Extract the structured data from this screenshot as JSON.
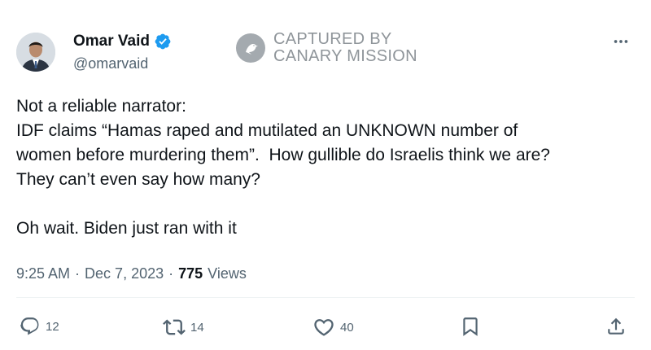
{
  "author": {
    "name": "Omar Vaid",
    "handle": "@omarvaid",
    "verified": true,
    "avatar_icon": "profile-photo"
  },
  "watermark": {
    "line1": "CAPTURED BY",
    "line2": "CANARY MISSION",
    "icon": "canary-bird-icon"
  },
  "tweet": {
    "lines": [
      "Not a reliable narrator:",
      "IDF claims “Hamas raped and mutilated an UNKNOWN number of",
      "women before murdering them”.  How gullible do Israelis think we are?",
      "They can’t even say how many?",
      "",
      "Oh wait. Biden just ran with it"
    ]
  },
  "meta": {
    "time": "9:25 AM",
    "separator": "·",
    "date": "Dec 7, 2023",
    "views_count": "775",
    "views_label": "Views"
  },
  "actions": {
    "replies": "12",
    "reposts": "14",
    "likes": "40"
  },
  "colors": {
    "verified": "#1d9bf0",
    "secondary_text": "#536471",
    "primary_text": "#0f1419",
    "watermark": "#8f959a"
  }
}
